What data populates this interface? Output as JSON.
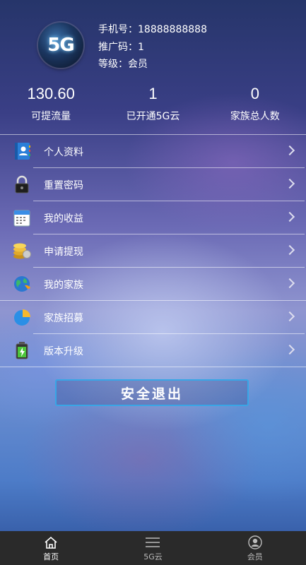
{
  "profile": {
    "avatar_text": "5G",
    "phone": "手机号：18888888888",
    "referral": "推广码：1",
    "level": "等级：会员"
  },
  "stats": [
    {
      "value": "130.60",
      "label": "可提流量"
    },
    {
      "value": "1",
      "label": "已开通5G云"
    },
    {
      "value": "0",
      "label": "家族总人数"
    }
  ],
  "menu": [
    {
      "label": "个人资料",
      "icon": "contacts-book-icon"
    },
    {
      "label": "重置密码",
      "icon": "padlock-icon"
    },
    {
      "label": "我的收益",
      "icon": "calendar-icon"
    },
    {
      "label": "申请提现",
      "icon": "coins-icon"
    },
    {
      "label": "我的家族",
      "icon": "globe-icon"
    },
    {
      "label": "家族招募",
      "icon": "pie-chart-icon"
    },
    {
      "label": "版本升级",
      "icon": "battery-icon"
    }
  ],
  "logout_label": "安全退出",
  "tabbar": [
    {
      "label": "首页",
      "icon": "home-icon",
      "active": true
    },
    {
      "label": "5G云",
      "icon": "menu-lines-icon",
      "active": false
    },
    {
      "label": "会员",
      "icon": "user-icon",
      "active": false
    }
  ],
  "colors": {
    "accent_border": "#38a6e6",
    "tabbar_bg": "#2a2a2a"
  }
}
